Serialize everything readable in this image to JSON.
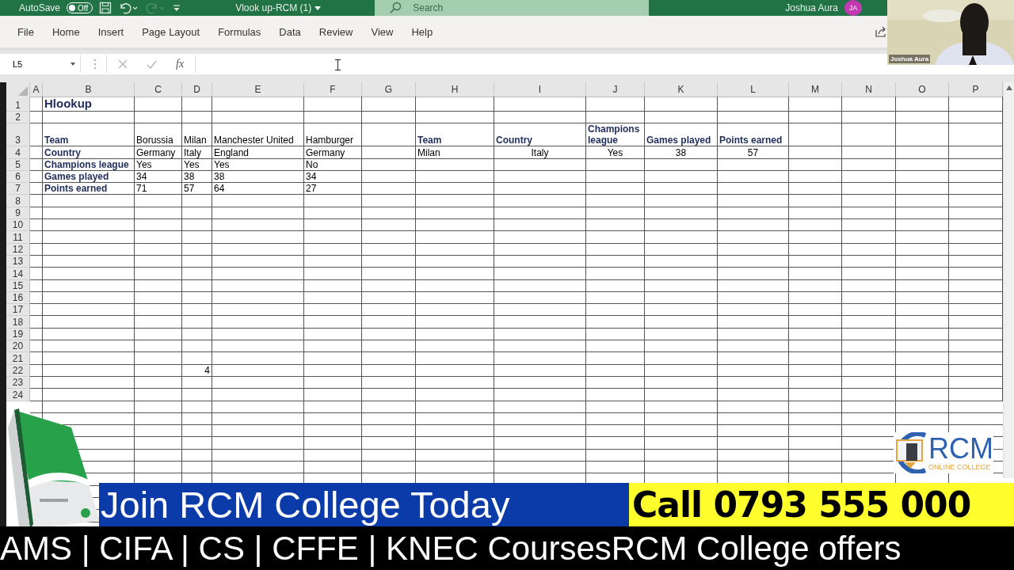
{
  "title_bar": {
    "autosave": {
      "label": "AutoSave",
      "toggle_text": "Off",
      "on": false
    },
    "quick_access": [
      {
        "kind": "save",
        "disabled": false
      },
      {
        "kind": "undo",
        "disabled": false
      },
      {
        "kind": "redo",
        "disabled": true
      },
      {
        "kind": "customize",
        "disabled": false
      }
    ],
    "document_title": "Vlook up-RCM (1)",
    "search": {
      "placeholder": "Search"
    },
    "user_name": "Joshua Aura",
    "avatar_initials": "JA"
  },
  "ribbon_tabs": [
    {
      "label": "File",
      "selected": false
    },
    {
      "label": "Home",
      "selected": false
    },
    {
      "label": "Insert",
      "selected": false
    },
    {
      "label": "Page Layout",
      "selected": false
    },
    {
      "label": "Formulas",
      "selected": false
    },
    {
      "label": "Data",
      "selected": false
    },
    {
      "label": "Review",
      "selected": false
    },
    {
      "label": "View",
      "selected": false
    },
    {
      "label": "Help",
      "selected": false
    }
  ],
  "formula_bar": {
    "name_box": "L5",
    "buttons": [
      {
        "kind": "cancel",
        "disabled": true
      },
      {
        "kind": "enter",
        "disabled": true
      }
    ],
    "function_label": "fx"
  },
  "sheet": {
    "columns": [
      "A",
      "B",
      "C",
      "D",
      "E",
      "F",
      "G",
      "H",
      "I",
      "J",
      "K",
      "L",
      "M",
      "N",
      "O",
      "P"
    ],
    "rows": [
      {
        "number": "1",
        "cells": [
          null,
          {
            "text": "Hlookup",
            "bold": true,
            "kind": "title"
          }
        ]
      },
      {
        "number": "2"
      },
      {
        "number": "3",
        "cells": [
          null,
          {
            "text": "Team",
            "bold": true
          },
          {
            "text": "Borussia",
            "bold": false
          },
          {
            "text": "Milan",
            "bold": false
          },
          {
            "text": "Manchester United",
            "bold": false
          },
          {
            "text": "Hamburger",
            "bold": false
          },
          null,
          {
            "text": "Team",
            "bold": true
          },
          {
            "text": "Country",
            "bold": true
          },
          {
            "text": "Champions league",
            "bold": true
          },
          {
            "text": "Games played",
            "bold": true
          },
          {
            "text": "Points earned",
            "bold": true
          }
        ]
      },
      {
        "number": "4",
        "cells": [
          null,
          {
            "text": "Country",
            "bold": true
          },
          {
            "text": "Germany",
            "bold": false
          },
          {
            "text": "Italy",
            "bold": false
          },
          {
            "text": "England",
            "bold": false
          },
          {
            "text": "Germany",
            "bold": false
          },
          null,
          {
            "text": "Milan",
            "bold": false
          },
          {
            "text": "Italy",
            "bold": false,
            "kind": "centered"
          },
          {
            "text": "Yes",
            "bold": false,
            "kind": "centered"
          },
          {
            "text": "38",
            "bold": false,
            "kind": "centered"
          },
          {
            "text": "57",
            "bold": false,
            "kind": "centered"
          }
        ]
      },
      {
        "number": "5",
        "cells": [
          null,
          {
            "text": "Champions league",
            "bold": true
          },
          {
            "text": "Yes",
            "bold": false
          },
          {
            "text": "Yes",
            "bold": false
          },
          {
            "text": "Yes",
            "bold": false
          },
          {
            "text": "No",
            "bold": false
          }
        ]
      },
      {
        "number": "6",
        "cells": [
          null,
          {
            "text": "Games played",
            "bold": true
          },
          {
            "text": "34",
            "bold": false
          },
          {
            "text": "38",
            "bold": false
          },
          {
            "text": "38",
            "bold": false
          },
          {
            "text": "34",
            "bold": false
          }
        ]
      },
      {
        "number": "7",
        "cells": [
          null,
          {
            "text": "Points earned",
            "bold": true
          },
          {
            "text": "71",
            "bold": false
          },
          {
            "text": "57",
            "bold": false
          },
          {
            "text": "64",
            "bold": false
          },
          {
            "text": "27",
            "bold": false
          }
        ]
      },
      {
        "number": "8"
      },
      {
        "number": "9"
      },
      {
        "number": "10"
      },
      {
        "number": "11"
      },
      {
        "number": "12"
      },
      {
        "number": "13"
      },
      {
        "number": "14"
      },
      {
        "number": "15"
      },
      {
        "number": "16"
      },
      {
        "number": "17"
      },
      {
        "number": "18"
      },
      {
        "number": "19"
      },
      {
        "number": "20"
      },
      {
        "number": "21"
      },
      {
        "number": "22",
        "cells": [
          null,
          null,
          null,
          {
            "text": "4",
            "bold": false,
            "kind": "number"
          }
        ]
      },
      {
        "number": "23"
      },
      {
        "number": "24"
      }
    ]
  },
  "webcam": {
    "name_label": "Joshua Aura"
  },
  "logo": {
    "mark": "RCM",
    "subtitle": "ONLINE COLLEGE"
  },
  "banner": {
    "join_text": "Join RCM College Today",
    "call_text": "Call 0793 555 000",
    "ticker": "AMS | CIFA | CS | CFFE | KNEC CoursesRCM College offers"
  }
}
